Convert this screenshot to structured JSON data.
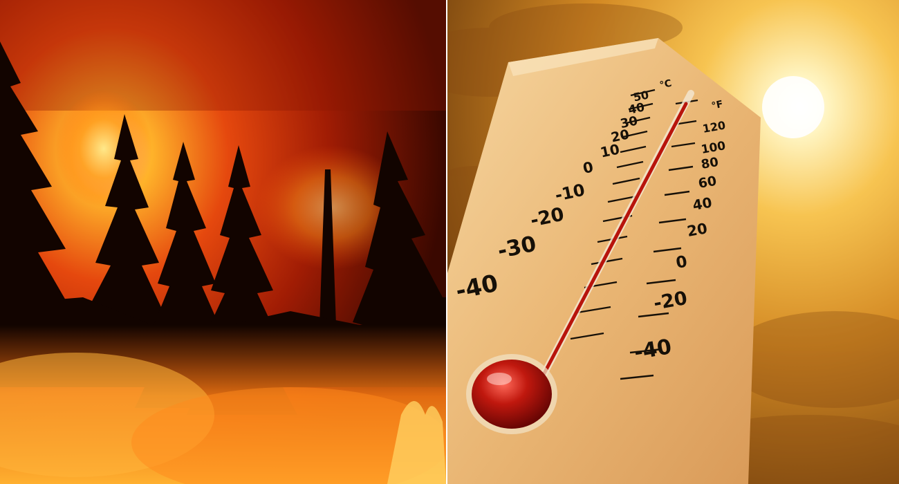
{
  "scene": {
    "left_panel": "forest-wildfire",
    "right_panel": "thermometer-in-sun"
  },
  "thermometer": {
    "celsius_unit": "°C",
    "fahrenheit_unit": "°F",
    "celsius_labels": [
      "50",
      "40",
      "30",
      "20",
      "10",
      "0",
      "-10",
      "-20",
      "-30",
      "-40"
    ],
    "fahrenheit_labels": [
      "120",
      "100",
      "80",
      "60",
      "40",
      "20",
      "0",
      "-20",
      "-40"
    ]
  },
  "colors": {
    "fire_dark": "#3a0800",
    "fire_red": "#c22a08",
    "fire_orange": "#ff7a12",
    "fire_glow": "#ffd54a",
    "sky_light": "#fff1b0",
    "sky_gold": "#e8a030",
    "sky_brown": "#7a4510",
    "wood": "#e9b873",
    "mercury": "#b8140c",
    "ink": "#161008"
  }
}
